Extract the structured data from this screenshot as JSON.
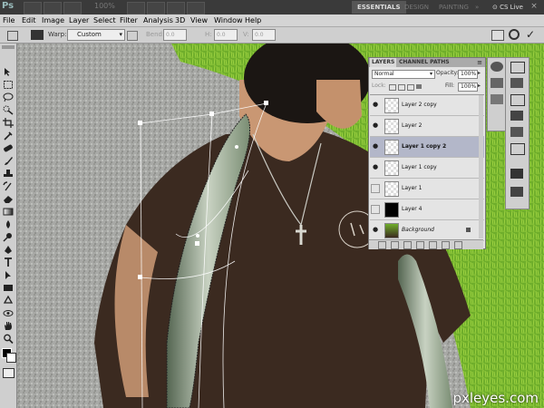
{
  "app": {
    "logo": "Ps",
    "zoom": "100%"
  },
  "workspaces": [
    "ESSENTIALS",
    "DESIGN",
    "PAINTING"
  ],
  "more_workspaces": "»",
  "cs_live": "CS Live",
  "menu": [
    "File",
    "Edit",
    "Image",
    "Layer",
    "Select",
    "Filter",
    "Analysis",
    "3D",
    "View",
    "Window",
    "Help"
  ],
  "options": {
    "warp_label": "Warp:",
    "warp_value": "Custom",
    "bend_label": "Bend:",
    "bend_value": "0.0",
    "h_label": "H:",
    "h_value": "0.0",
    "v_label": "V:",
    "v_value": "0.0"
  },
  "layers_panel": {
    "tabs": [
      "LAYERS",
      "CHANNEL PATHS"
    ],
    "blend_mode": "Normal",
    "opacity_label": "Opacity:",
    "opacity_value": "100%",
    "lock_label": "Lock:",
    "fill_label": "Fill:",
    "fill_value": "100%",
    "layers": [
      {
        "name": "Layer 2 copy",
        "visible": true,
        "selected": false
      },
      {
        "name": "Layer 2",
        "visible": true,
        "selected": false
      },
      {
        "name": "Layer 1 copy 2",
        "visible": true,
        "selected": true
      },
      {
        "name": "Layer 1 copy",
        "visible": true,
        "selected": false
      },
      {
        "name": "Layer 1",
        "visible": false,
        "selected": false
      },
      {
        "name": "Layer 4",
        "visible": false,
        "selected": false
      },
      {
        "name": "Background",
        "visible": true,
        "selected": false
      }
    ]
  },
  "watermark": "pxleyes.com"
}
